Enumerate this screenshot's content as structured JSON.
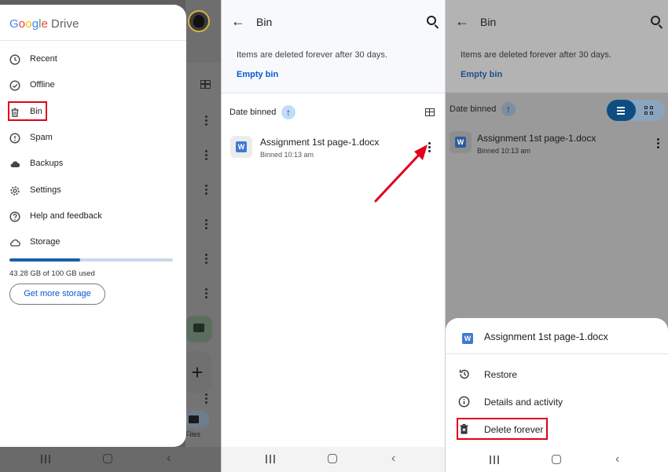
{
  "drawer": {
    "logo_google": [
      "G",
      "o",
      "o",
      "g",
      "l",
      "e"
    ],
    "logo_drive": "Drive",
    "items": [
      {
        "label": "Recent",
        "icon": "clock-icon"
      },
      {
        "label": "Offline",
        "icon": "offline-check-icon"
      },
      {
        "label": "Bin",
        "icon": "trash-icon"
      },
      {
        "label": "Spam",
        "icon": "spam-icon"
      },
      {
        "label": "Backups",
        "icon": "cloud-icon"
      },
      {
        "label": "Settings",
        "icon": "gear-icon"
      },
      {
        "label": "Help and feedback",
        "icon": "help-icon"
      },
      {
        "label": "Storage",
        "icon": "cloud-outline-icon"
      }
    ],
    "storage_used_fraction": 0.4328,
    "storage_text": "43.28 GB of 100 GB used",
    "get_more_storage": "Get more storage",
    "background_nav_label": "Files"
  },
  "bin_screen": {
    "title": "Bin",
    "notice": "Items are deleted forever after 30 days.",
    "empty_bin": "Empty bin",
    "sort_label": "Date binned",
    "sort_arrow": "↑",
    "file": {
      "name": "Assignment 1st page-1.docx",
      "subtitle": "Binned 10:13 am",
      "type_letter": "W"
    }
  },
  "sheet": {
    "file_name": "Assignment 1st page-1.docx",
    "items": [
      {
        "label": "Restore",
        "icon": "restore-icon"
      },
      {
        "label": "Details and activity",
        "icon": "info-icon"
      },
      {
        "label": "Delete forever",
        "icon": "delete-forever-icon"
      }
    ]
  },
  "symbols": {
    "back_arrow": "←",
    "system_back": "‹",
    "plus": "+"
  },
  "colors": {
    "accent": "#0b57d0",
    "highlight": "#e0001b",
    "annotation_arrow": "#e0001b"
  }
}
